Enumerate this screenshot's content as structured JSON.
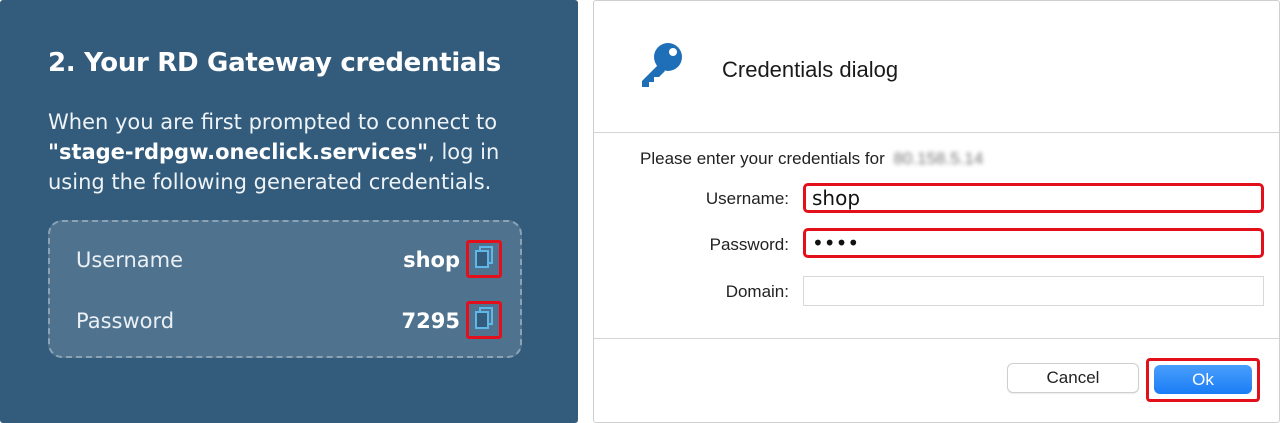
{
  "left": {
    "title": "2. Your RD Gateway credentials",
    "description_pre": "When you are first prompted to connect to ",
    "description_host": "\"stage-rdpgw.oneclick.services\"",
    "description_post": ", log in using the following generated credentials.",
    "username_label": "Username",
    "username_value": "shop",
    "password_label": "Password",
    "password_value": "7295",
    "icons": [
      "copy-icon",
      "copy-icon"
    ]
  },
  "dialog": {
    "title": "Credentials dialog",
    "icon": "key-icon",
    "prompt": "Please enter your credentials for",
    "host_blurred": "80.158.5.14",
    "username_label": "Username:",
    "username_value": "shop",
    "password_label": "Password:",
    "password_value": "••••",
    "domain_label": "Domain:",
    "domain_value": "",
    "cancel_label": "Cancel",
    "ok_label": "Ok"
  },
  "colors": {
    "panel_bg": "#335c7c",
    "highlight": "#e3101b",
    "ok_button": "#1a7cf5",
    "key_icon": "#1f6fb8"
  }
}
